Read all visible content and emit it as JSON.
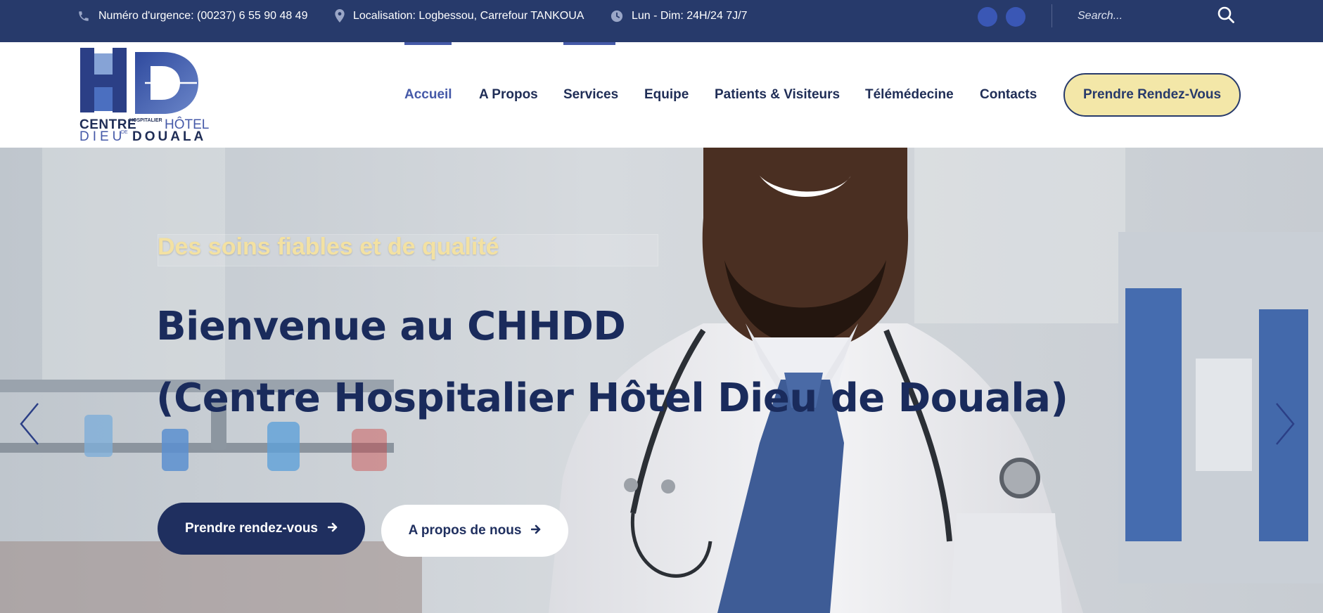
{
  "topbar": {
    "phone_text": "Numéro d'urgence: (00237) 6 55 90 48 49",
    "location_text": "Localisation: Logbessou, Carrefour TANKOUA",
    "hours_text": "Lun - Dim: 24H/24 7J/7",
    "search_placeholder": "Search..."
  },
  "logo": {
    "line1_left": "CENTRE",
    "line1_small": "HOSPITALIER",
    "line1_right": "HÔTEL",
    "line2_left": "DIEU",
    "line2_small": "DE",
    "line2_right": "DOUALA"
  },
  "nav": {
    "items": [
      {
        "label": "Accueil",
        "active": true
      },
      {
        "label": "A Propos"
      },
      {
        "label": "Services"
      },
      {
        "label": "Equipe"
      },
      {
        "label": "Patients & Visiteurs"
      },
      {
        "label": "Télémédecine"
      },
      {
        "label": "Contacts"
      }
    ],
    "cta_label": "Prendre Rendez-Vous"
  },
  "hero": {
    "tagline": "Des soins fiables et de qualité",
    "title_line1": "Bienvenue au CHHDD",
    "title_line2": "(Centre Hospitalier Hôtel Dieu de Douala)",
    "primary_button": "Prendre rendez-vous",
    "secondary_button": "A propos de nous"
  },
  "colors": {
    "topbar_bg": "#273a6b",
    "nav_text": "#1f2d56",
    "nav_active": "#4559a8",
    "cta_bg": "#f3e7a8",
    "tagline": "#f3e1a2",
    "hero_title": "#1a2b5c",
    "primary_button_bg": "#1f2f5f"
  },
  "icons": [
    "phone-icon",
    "location-pin-icon",
    "clock-icon",
    "search-icon",
    "arrow-right-icon",
    "chevron-left-icon",
    "chevron-right-icon"
  ]
}
